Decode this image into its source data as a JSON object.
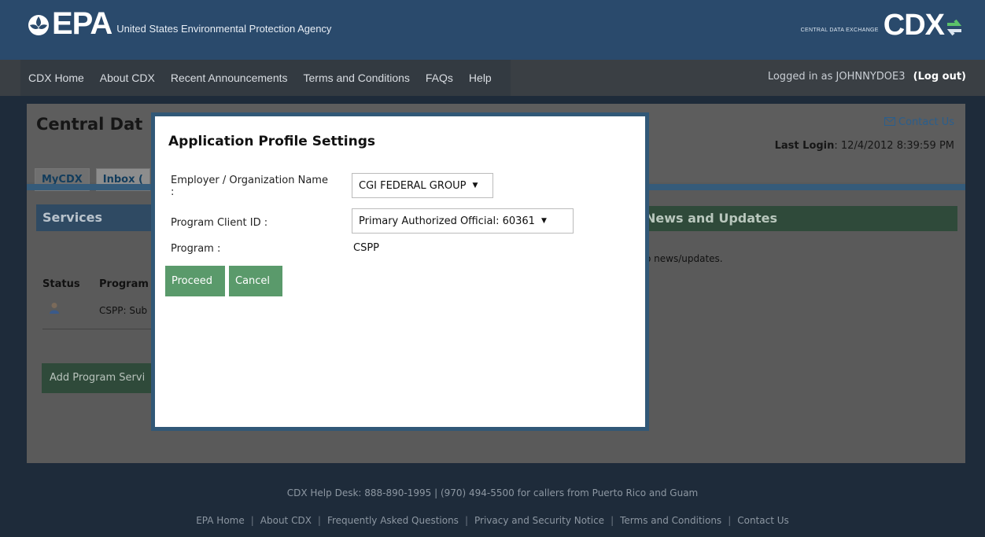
{
  "header": {
    "epa_logo_text": "EPA",
    "agency_name": "United States Environmental Protection Agency",
    "cdx_small": "CENTRAL DATA EXCHANGE",
    "cdx_logo_text": "CDX"
  },
  "nav": {
    "items": [
      "CDX Home",
      "About CDX",
      "Recent Announcements",
      "Terms and Conditions",
      "FAQs",
      "Help"
    ],
    "logged_in_text": "Logged in as JOHNNYDOE3",
    "logout_label": "(Log out)"
  },
  "main": {
    "title": "Central Dat",
    "contact_us": "Contact Us",
    "last_login_label": "Last Login",
    "last_login_value": ": 12/4/2012 8:39:59 PM",
    "tabs": [
      "MyCDX",
      "Inbox ("
    ],
    "services_title": "Services",
    "table": {
      "status_header": "Status",
      "program_header": "Program",
      "row_program": "CSPP: Sub"
    },
    "add_button": "Add Program Servi",
    "news_title": "News and Updates",
    "news_text": "o news/updates."
  },
  "modal": {
    "title": "Application Profile Settings",
    "employer_label": "Employer / Organization Name :",
    "employer_value": "CGI FEDERAL GROUP",
    "client_id_label": "Program Client ID :",
    "client_id_value": "Primary Authorized Official: 60361",
    "program_label": "Program :",
    "program_value": "CSPP",
    "proceed_label": "Proceed",
    "cancel_label": "Cancel"
  },
  "footer": {
    "help_desk": "CDX Help Desk: 888-890-1995 | (970) 494-5500 for callers from Puerto Rico and Guam",
    "links": [
      "EPA Home",
      "About CDX",
      "Frequently Asked Questions",
      "Privacy and Security Notice",
      "Terms and Conditions",
      "Contact Us"
    ]
  },
  "colors": {
    "header_blue": "#2a4a6c",
    "modal_border": "#315877",
    "button_green": "#5a9a6b"
  }
}
